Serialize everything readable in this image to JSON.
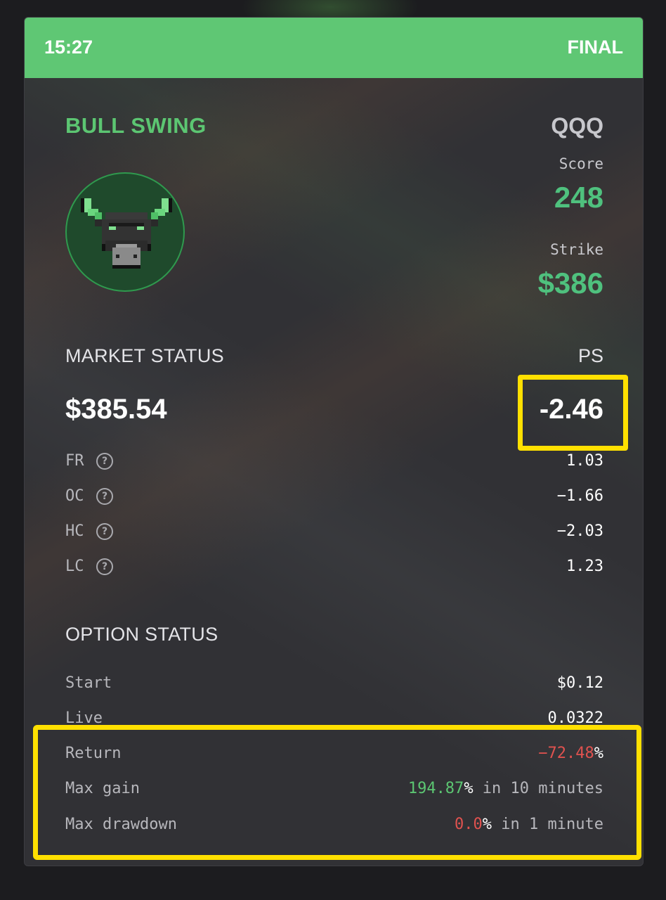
{
  "header": {
    "time": "15:27",
    "status": "FINAL"
  },
  "signal": {
    "title": "BULL SWING",
    "ticker": "QQQ",
    "score_label": "Score",
    "score": "248",
    "strike_label": "Strike",
    "strike": "$386"
  },
  "market": {
    "title": "MARKET STATUS",
    "ps_label": "PS",
    "price": "$385.54",
    "ps_value": "-2.46",
    "metrics": [
      {
        "label": "FR",
        "value": "1.03"
      },
      {
        "label": "OC",
        "value": "−1.66"
      },
      {
        "label": "HC",
        "value": "−2.03"
      },
      {
        "label": "LC",
        "value": "1.23"
      }
    ],
    "help_glyph": "?"
  },
  "option": {
    "title": "OPTION STATUS",
    "start_label": "Start",
    "start_value": "$0.12",
    "live_label": "Live",
    "live_value": "0.0322",
    "return_label": "Return",
    "return_value": "−72.48",
    "percent": "%",
    "max_gain_label": "Max gain",
    "max_gain_value": "194.87",
    "max_gain_suffix": " in 10 minutes",
    "max_drawdown_label": "Max drawdown",
    "max_drawdown_value": "0.0",
    "max_drawdown_suffix": " in 1 minute"
  },
  "colors": {
    "accent_green": "#5fc774",
    "negative_red": "#e0524f",
    "highlight_yellow": "#ffe000"
  },
  "icons": {
    "avatar": "bull-avatar-icon",
    "help": "help-circle-icon"
  }
}
